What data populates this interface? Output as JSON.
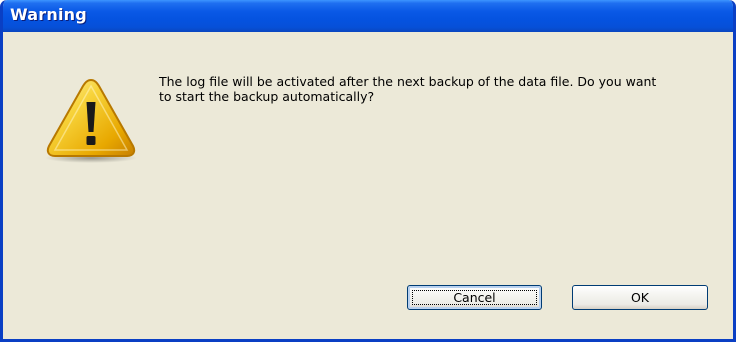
{
  "window": {
    "title": "Warning"
  },
  "dialog": {
    "icon": "warning-triangle-icon",
    "message_line1": "The log file will be activated after the next backup of the data file. Do you want",
    "message_line2": "to start the backup automatically?"
  },
  "buttons": {
    "cancel_label": "Cancel",
    "ok_label": "OK"
  },
  "colors": {
    "titlebar": "#0553e0",
    "dialog_background": "#ece9d8",
    "warning_yellow": "#f5c400"
  }
}
